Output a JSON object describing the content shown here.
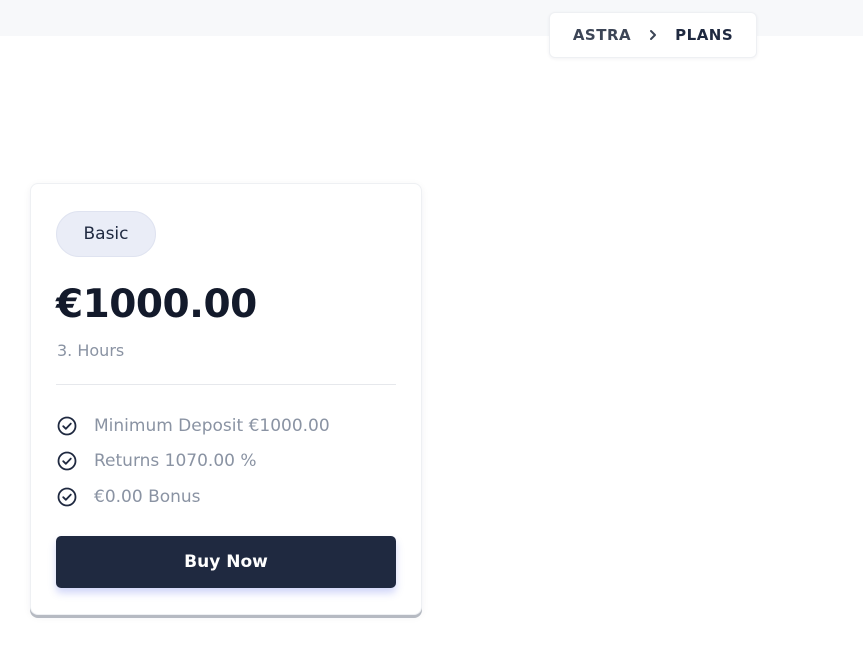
{
  "breadcrumb": {
    "items": [
      "ASTRA",
      "PLANS"
    ]
  },
  "plan": {
    "badge": "Basic",
    "price": "€1000.00",
    "duration": "3. Hours",
    "features": [
      {
        "icon": "check-circle-icon",
        "text": "Minimum Deposit €1000.00"
      },
      {
        "icon": "check-circle-icon",
        "text": "Returns 1070.00 %"
      },
      {
        "icon": "check-circle-icon",
        "text": "€0.00 Bonus"
      }
    ],
    "button_label": "Buy Now"
  },
  "colors": {
    "primary": "#1f2940",
    "badge_bg": "#eaedf7",
    "muted_text": "#8a93a3"
  }
}
